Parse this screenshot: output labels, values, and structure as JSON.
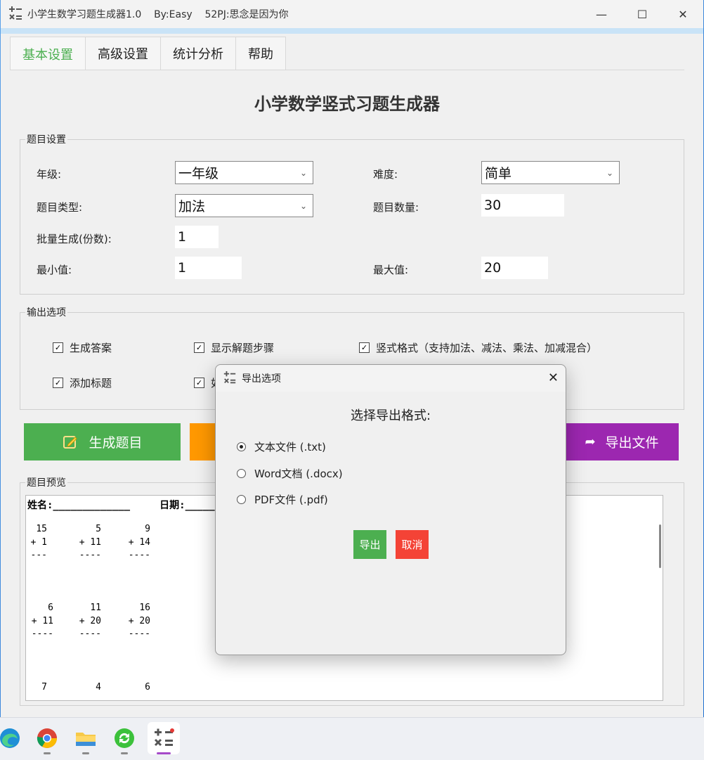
{
  "window": {
    "title": "小学生数学习题生成器1.0    By:Easy    52PJ:思念是因为你"
  },
  "tabs": [
    "基本设置",
    "高级设置",
    "统计分析",
    "帮助"
  ],
  "page_title": "小学数学竖式习题生成器",
  "question_settings": {
    "group_label": "题目设置",
    "grade_label": "年级:",
    "grade_value": "一年级",
    "difficulty_label": "难度:",
    "difficulty_value": "简单",
    "type_label": "题目类型:",
    "type_value": "加法",
    "count_label": "题目数量:",
    "count_value": "30",
    "batch_label": "批量生成(份数):",
    "batch_value": "1",
    "min_label": "最小值:",
    "min_value": "1",
    "max_label": "最大值:",
    "max_value": "20"
  },
  "output_options": {
    "group_label": "输出选项",
    "checkboxes": [
      {
        "label": "生成答案",
        "checked": true
      },
      {
        "label": "显示解题步骤",
        "checked": true
      },
      {
        "label": "竖式格式（支持加法、减法、乘法、加减混合）",
        "checked": true
      },
      {
        "label": "添加标题",
        "checked": true
      },
      {
        "label": "如",
        "checked": true
      }
    ]
  },
  "actions": {
    "generate_label": "生成题目",
    "export_label": "导出文件",
    "colors": {
      "generate": "#4caf50",
      "middle": "#ff9800",
      "export": "#9c27b0"
    }
  },
  "preview": {
    "group_label": "题目预览",
    "header": "姓名:_____________     日期:_____",
    "rows": [
      [
        "15\n+ 1\n---",
        "5\n+ 11\n----",
        "9\n+ 14\n----"
      ],
      [
        "6\n+ 11\n----",
        "11\n+ 20\n----",
        "16\n+ 20\n----"
      ],
      [
        "7",
        "4",
        "6"
      ]
    ]
  },
  "dialog": {
    "title": "导出选项",
    "heading": "选择导出格式:",
    "options": [
      {
        "label": "文本文件 (.txt)",
        "selected": true
      },
      {
        "label": "Word文档 (.docx)",
        "selected": false
      },
      {
        "label": "PDF文件 (.pdf)",
        "selected": false
      }
    ],
    "export_label": "导出",
    "cancel_label": "取消",
    "colors": {
      "export": "#4caf50",
      "cancel": "#f44336"
    }
  },
  "taskbar": {
    "icons": [
      "edge-icon",
      "chrome-icon",
      "file-explorer-icon",
      "sync-app-icon",
      "math-generator-icon"
    ]
  }
}
